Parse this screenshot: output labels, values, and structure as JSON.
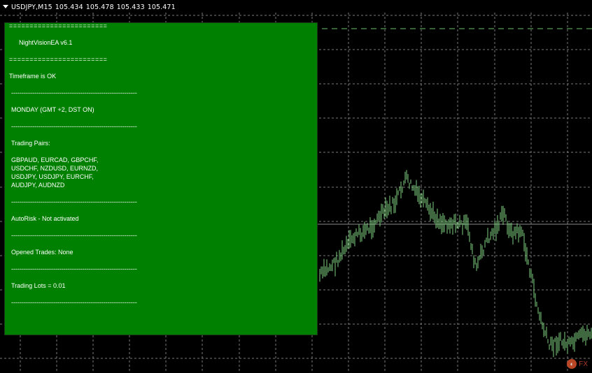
{
  "chart": {
    "symbol": "USDJPY,M15",
    "open": "105.434",
    "high": "105.478",
    "low": "105.433",
    "close": "105.471",
    "colors": {
      "background": "#000000",
      "grid": "#7a7a7a",
      "price": "#7fd07f",
      "panel": "#008000"
    }
  },
  "panel": {
    "separator": "========================",
    "ea_name": "NightVisionEA  v6.1",
    "timeframe_status": "Timeframe is OK",
    "dash_line": "------------------------------------------------------------",
    "day": "MONDAY    (GMT +2, DST ON)",
    "pairs_label": "Trading Pairs:",
    "pairs_lines": [
      "GBPAUD, EURCAD, GBPCHF,",
      "USDCHF, NZDUSD, EURNZD,",
      "USDJPY, USDJPY, EURCHF,",
      "AUDJPY, AUDNZD"
    ],
    "autorisk": "AutoRisk - Not activated",
    "opened_trades": "Opened Trades: None",
    "trading_lots": "Trading Lots = 0.01"
  },
  "watermark": {
    "logo_icon": "fxdaily-logo-icon"
  }
}
